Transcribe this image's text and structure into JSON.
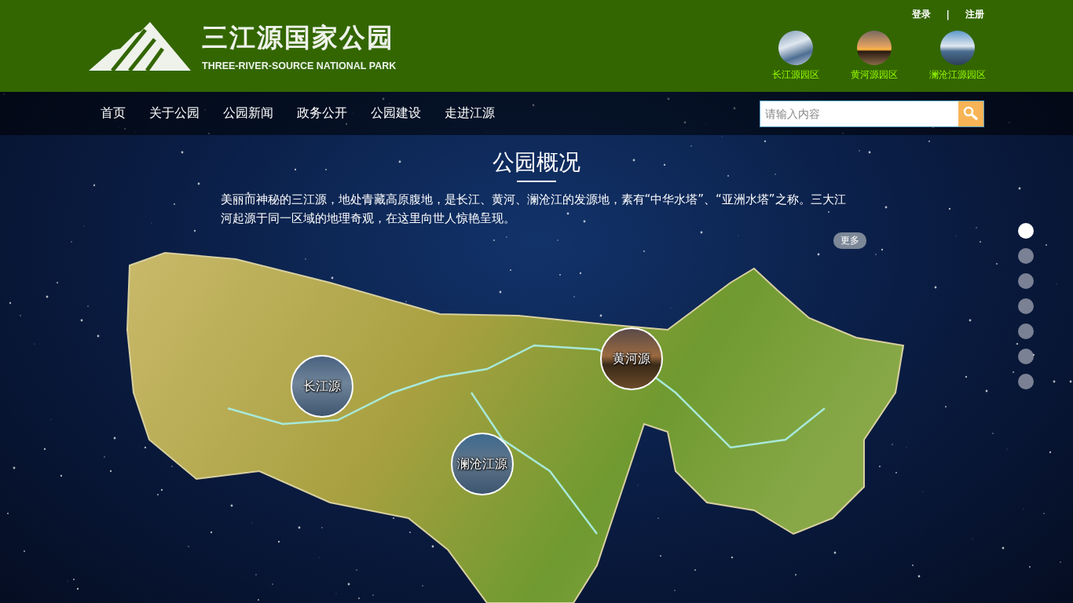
{
  "header": {
    "logo_title": "三江源国家公园",
    "logo_subtitle": "THREE-RIVER-SOURCE NATIONAL PARK",
    "auth_links": [
      "登录",
      "|",
      "注册"
    ],
    "park_areas": [
      {
        "label": "长江源园区",
        "kind": "snow"
      },
      {
        "label": "黄河源园区",
        "kind": "sunset"
      },
      {
        "label": "澜沧江源园区",
        "kind": "river"
      }
    ]
  },
  "nav": {
    "items": [
      "首页",
      "关于公园",
      "公园新闻",
      "政务公开",
      "公园建设",
      "走进江源"
    ],
    "search": {
      "placeholder": "请输入内容"
    }
  },
  "overview": {
    "title": "公园概况",
    "text": "美丽而神秘的三江源，地处青藏高原腹地，是长江、黄河、澜沧江的发源地，素有“中华水塔”、“亚洲水塔”之称。三大江河起源于同一区域的地理奇观，在这里向世人惊艳呈现。",
    "more": "更多"
  },
  "map_markers": [
    {
      "label": "长江源",
      "kind": "snow"
    },
    {
      "label": "黄河源",
      "kind": "sunset"
    },
    {
      "label": "澜沧江源",
      "kind": "river"
    }
  ],
  "page_dots": [
    {
      "selected": true
    },
    {
      "selected": false
    },
    {
      "selected": false
    },
    {
      "selected": false
    },
    {
      "selected": false
    },
    {
      "selected": false
    },
    {
      "selected": false
    }
  ]
}
